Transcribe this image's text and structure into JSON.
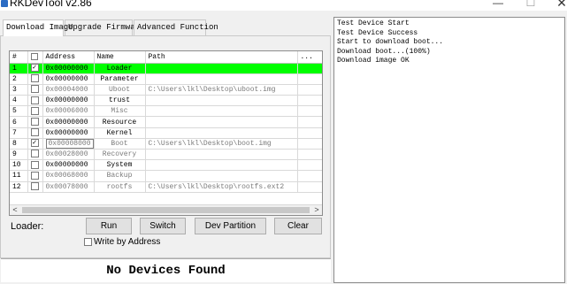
{
  "window": {
    "title": "RKDevTool v2.86",
    "minimize_glyph": "—",
    "maximize_glyph": "☐",
    "close_glyph": "✕"
  },
  "tabs": [
    {
      "label": "Download Image",
      "active": true
    },
    {
      "label": "Upgrade Firmware",
      "active": false
    },
    {
      "label": "Advanced Function",
      "active": false
    }
  ],
  "table": {
    "columns": [
      "#",
      "",
      "Address",
      "Name",
      "Path",
      "..."
    ],
    "rows": [
      {
        "num": "1",
        "checked": true,
        "address": "0x00000000",
        "name": "Loader",
        "path": ""
      },
      {
        "num": "2",
        "checked": false,
        "address": "0x00000000",
        "name": "Parameter",
        "path": ""
      },
      {
        "num": "3",
        "checked": false,
        "address": "0x00004000",
        "name": "Uboot",
        "path": "C:\\Users\\lkl\\Desktop\\uboot.img"
      },
      {
        "num": "4",
        "checked": false,
        "address": "0x00000000",
        "name": "trust",
        "path": ""
      },
      {
        "num": "5",
        "checked": false,
        "address": "0x00006000",
        "name": "Misc",
        "path": ""
      },
      {
        "num": "6",
        "checked": false,
        "address": "0x00000000",
        "name": "Resource",
        "path": ""
      },
      {
        "num": "7",
        "checked": false,
        "address": "0x00000000",
        "name": "Kernel",
        "path": ""
      },
      {
        "num": "8",
        "checked": true,
        "address": "0x00008000",
        "name": "Boot",
        "path": "C:\\Users\\lkl\\Desktop\\boot.img"
      },
      {
        "num": "9",
        "checked": false,
        "address": "0x00028000",
        "name": "Recovery",
        "path": ""
      },
      {
        "num": "10",
        "checked": false,
        "address": "0x00000000",
        "name": "System",
        "path": ""
      },
      {
        "num": "11",
        "checked": false,
        "address": "0x00068000",
        "name": "Backup",
        "path": ""
      },
      {
        "num": "12",
        "checked": false,
        "address": "0x00078000",
        "name": "rootfs",
        "path": "C:\\Users\\lkl\\Desktop\\rootfs.ext2"
      }
    ],
    "scroll_left": "<",
    "scroll_right": ">"
  },
  "controls": {
    "loader_label": "Loader:",
    "run": "Run",
    "switch": "Switch",
    "dev_partition": "Dev Partition",
    "clear": "Clear",
    "write_by_address": "Write by Address",
    "write_by_address_checked": false
  },
  "status": "No Devices Found",
  "log": [
    "Test Device Start",
    "Test Device Success",
    "Start to download boot...",
    "Download boot...(100%)",
    "Download image OK"
  ],
  "colors": {
    "selected_row": "#00ff00",
    "app_icon": "#2b6cc4"
  }
}
